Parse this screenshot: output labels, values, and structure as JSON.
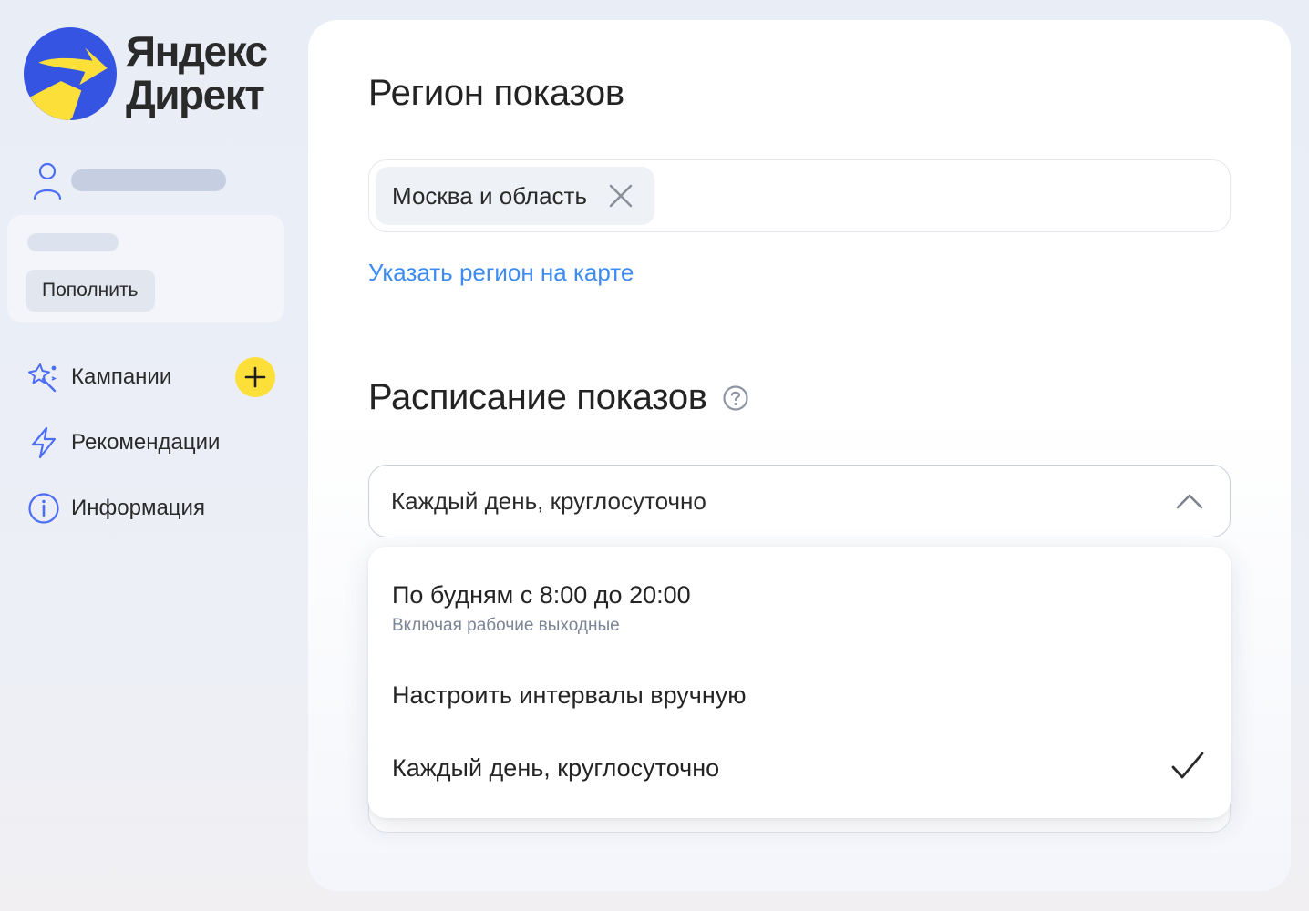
{
  "brand": {
    "line1": "Яндекс",
    "line2": "Директ",
    "colors": {
      "blue": "#3554e2",
      "yellow": "#fddf3a",
      "accent_link": "#3c8cf3"
    }
  },
  "sidebar": {
    "user_icon": "person-icon",
    "topup_label": "Пополнить",
    "items": [
      {
        "label": "Кампании",
        "icon": "sparkle-wand-icon",
        "has_add": true,
        "add_icon": "plus-icon"
      },
      {
        "label": "Рекомендации",
        "icon": "lightning-icon"
      },
      {
        "label": "Информация",
        "icon": "info-icon"
      }
    ]
  },
  "main": {
    "region": {
      "title": "Регион показов",
      "chip": "Москва и область",
      "chip_remove_icon": "close-icon",
      "map_link": "Указать регион на карте"
    },
    "schedule": {
      "title": "Расписание показов",
      "help_icon": "question-circle-icon",
      "selected": "Каждый день, круглосуточно",
      "chevron_icon": "chevron-up-icon",
      "options": [
        {
          "title": "По будням с 8:00 до 20:00",
          "subtitle": "Включая рабочие выходные"
        },
        {
          "title": "Настроить интервалы вручную"
        },
        {
          "title": "Каждый день, круглосуточно",
          "checked": true,
          "check_icon": "checkmark-icon"
        }
      ]
    }
  }
}
